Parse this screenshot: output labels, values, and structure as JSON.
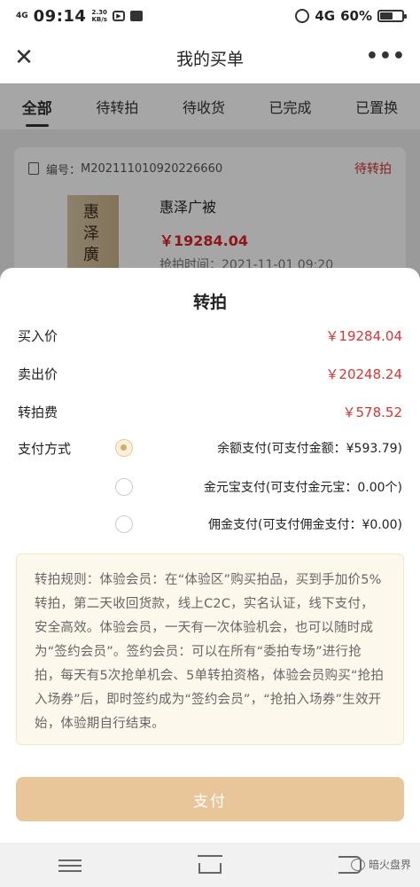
{
  "status_bar": {
    "signal_left": "4G",
    "time": "09:14",
    "speed_value": "2.30",
    "speed_unit": "KB/s",
    "signal_right": "4G",
    "battery": "60%",
    "battery_level": 0.6
  },
  "header": {
    "title": "我的买单"
  },
  "tabs": [
    "全部",
    "待转拍",
    "待收货",
    "已完成",
    "已置换"
  ],
  "order": {
    "number_label": "编号：",
    "number": "M202111010920226660",
    "status": "待转拍",
    "product_name": "惠泽广被",
    "thumb_text": "惠泽廣",
    "price": "￥19284.04",
    "time_label": "抢拍时间：",
    "time": "2021-11-01 09:20"
  },
  "sheet": {
    "title": "转拍",
    "buy_price_label": "买入价",
    "buy_price": "￥19284.04",
    "sell_price_label": "卖出价",
    "sell_price": "￥20248.24",
    "fee_label": "转拍费",
    "fee": "￥578.52",
    "pay_method_label": "支付方式",
    "pay_options": [
      "余额支付(可支付金额：¥593.79)",
      "金元宝支付(可支付金元宝：0.00个)",
      "佣金支付(可支付佣金支付：¥0.00)"
    ],
    "rules": "转拍规则：体验会员：在“体验区”购买拍品，买到手加价5%转拍，第二天收回货款，线上C2C，实名认证，线下支付，安全高效。体验会员，一天有一次体验机会，也可以随时成为“签约会员”。签约会员：可以在所有“委拍专场”进行抢拍，每天有5次抢单机会、5单转拍资格，体验会员购买“抢拍入场券”后，即时签约成为“签约会员”，“抢拍入场券”生效开始，体验期自行结束。",
    "pay_button": "支付"
  },
  "watermark": "暗火盘界"
}
